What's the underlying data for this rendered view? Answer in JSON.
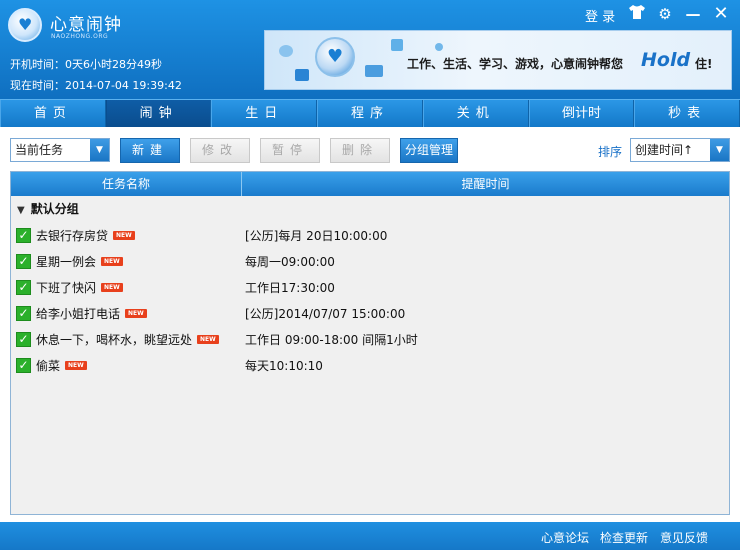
{
  "app": {
    "title": "心意闹钟",
    "domain": "NAOZHONG.ORG",
    "uptime": "开机时间：0天6小时28分49秒",
    "now": "现在时间：2014-07-04 19:39:42"
  },
  "window_controls": {
    "login": "登 录",
    "icons": [
      "shirt-icon",
      "gear-icon",
      "minimize-icon",
      "close-icon"
    ]
  },
  "banner": {
    "text": "工作、生活、学习、游戏，心意闹钟帮您",
    "hold": "Hold",
    "tail": "住!"
  },
  "nav": {
    "tabs": [
      {
        "label": "首页",
        "active": false
      },
      {
        "label": "闹钟",
        "active": true
      },
      {
        "label": "生日",
        "active": false
      },
      {
        "label": "程序",
        "active": false
      },
      {
        "label": "关机",
        "active": false
      },
      {
        "label": "倒计时",
        "active": false
      },
      {
        "label": "秒表",
        "active": false
      }
    ]
  },
  "toolbar": {
    "task_filter": "当前任务",
    "new": "新建",
    "edit": "修改",
    "pause": "暂停",
    "delete": "删除",
    "group_manage": "分组管理",
    "sort_label": "排序",
    "sort_value": "创建时间↑"
  },
  "list": {
    "columns": [
      "任务名称",
      "提醒时间"
    ],
    "group": "默认分组",
    "badge": "NEW",
    "rows": [
      {
        "name": "去银行存房贷",
        "time": "[公历]每月 20日10:00:00",
        "checked": true
      },
      {
        "name": "星期一例会",
        "time": "每周一09:00:00",
        "checked": true
      },
      {
        "name": "下班了快闪",
        "time": "工作日17:30:00",
        "checked": true
      },
      {
        "name": "给李小姐打电话",
        "time": "[公历]2014/07/07 15:00:00",
        "checked": true
      },
      {
        "name": "休息一下，喝杯水，眺望远处",
        "time": "工作日 09:00-18:00 间隔1小时",
        "checked": true
      },
      {
        "name": "偷菜",
        "time": "每天10:10:10",
        "checked": true
      }
    ]
  },
  "footer": {
    "forum": "心意论坛",
    "update": "检查更新",
    "feedback": "意见反馈"
  }
}
